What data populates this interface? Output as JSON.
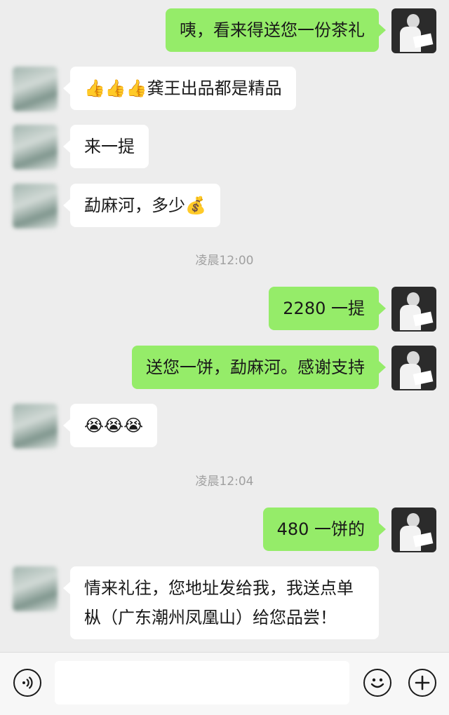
{
  "messages": [
    {
      "text": "咦，看来得送您一份茶礼"
    },
    {
      "text": "👍👍👍龚王出品都是精品"
    },
    {
      "text": "来一提"
    },
    {
      "text": "勐麻河，多少💰"
    },
    {
      "text": "2280 一提"
    },
    {
      "text": "送您一饼，勐麻河。感谢支持"
    },
    {
      "text": "😭😭😭"
    },
    {
      "text": "480 一饼的"
    },
    {
      "text": "情来礼往，您地址发给我，我送点单枞（广东潮州凤凰山）给您品尝！"
    }
  ],
  "timestamps": [
    "凌晨12:00",
    "凌晨12:04"
  ],
  "bottom_bar": {
    "voice_icon": "voice-icon",
    "emoji_icon": "emoji-icon",
    "plus_icon": "plus-icon",
    "input_value": ""
  },
  "colors": {
    "bubble_me": "#95ec69",
    "bubble_other": "#ffffff",
    "background": "#ededed"
  }
}
